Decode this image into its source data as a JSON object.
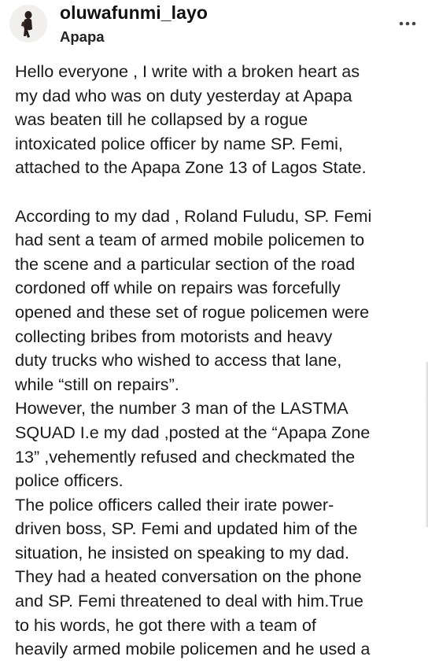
{
  "post": {
    "username": "oluwafunmi_layo",
    "location": "Apapa",
    "avatar_icon": "profile-silhouette-icon",
    "more_icon": "more-horizontal-icon"
  },
  "caption_lines": [
    "Hello everyone , I write with a broken heart as",
    "my dad who was on duty yesterday at Apapa",
    "was beaten till he collapsed by a rogue",
    "intoxicated police officer by name SP. Femi,",
    "attached to the Apapa Zone 13 of Lagos State.",
    "",
    "According to my dad , Roland Fuludu, SP. Femi",
    "had sent a team of armed mobile policemen to",
    "the scene and a particular section of the road",
    "cordoned off while on repairs was forcefully",
    "opened and these set of rogue policemen were",
    "collecting bribes from motorists and heavy",
    "duty trucks who wished to access that lane,",
    "while “still on repairs”.",
    "However, the number 3 man of the LASTMA",
    "SQUAD I.e my dad ,posted at the “Apapa Zone",
    "13” ,vehemently refused and checkmated the",
    "police officers.",
    "The police officers called their  irate power-",
    "driven boss, SP. Femi and updated him  of the",
    "situation, he insisted on speaking to my dad.",
    "They had a heated conversation on  the phone",
    "and SP. Femi threatened to deal with him.True",
    "to his words, he got there with a team of",
    "heavily armed mobile policemen and he used a"
  ]
}
